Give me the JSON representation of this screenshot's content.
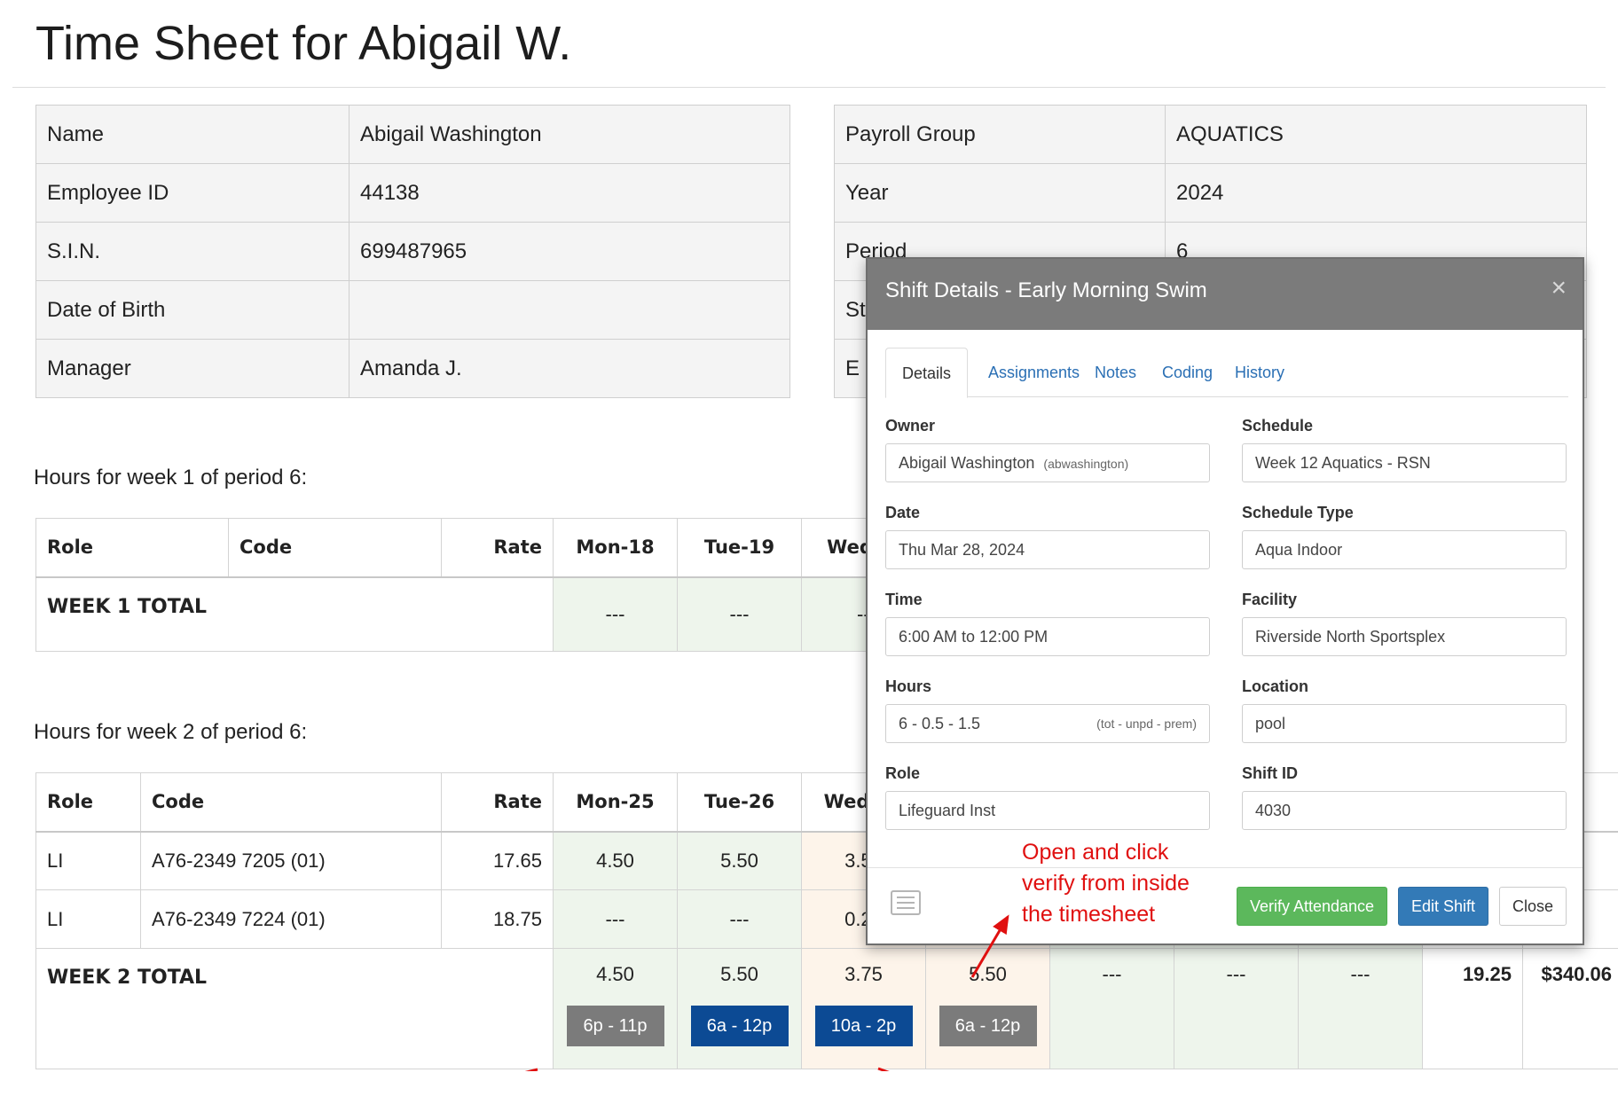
{
  "page_title": "Time Sheet for Abigail W.",
  "info_left": [
    {
      "label": "Name",
      "value": "Abigail Washington"
    },
    {
      "label": "Employee ID",
      "value": "44138"
    },
    {
      "label": "S.I.N.",
      "value": "699487965"
    },
    {
      "label": "Date of Birth",
      "value": ""
    },
    {
      "label": "Manager",
      "value": "Amanda J."
    }
  ],
  "info_right": [
    {
      "label": "Payroll Group",
      "value": "AQUATICS"
    },
    {
      "label": "Year",
      "value": "2024"
    },
    {
      "label": "Period",
      "value": "6"
    },
    {
      "label": "St",
      "value": ""
    },
    {
      "label": "E",
      "value": ""
    }
  ],
  "week1": {
    "label": "Hours for week 1 of period 6:",
    "headers": [
      "Role",
      "Code",
      "Rate",
      "Mon-18",
      "Tue-19",
      "Wed-20"
    ],
    "total_label": "WEEK 1 TOTAL",
    "totals": [
      "---",
      "---",
      "---"
    ]
  },
  "week2": {
    "label": "Hours for week 2 of period 6:",
    "headers": [
      "Role",
      "Code",
      "Rate",
      "Mon-25",
      "Tue-26",
      "Wed-27"
    ],
    "rows": [
      {
        "role": "LI",
        "code": "A76-2349 7205 (01)",
        "rate": "17.65",
        "mon": "4.50",
        "tue": "5.50",
        "wed": "3.50"
      },
      {
        "role": "LI",
        "code": "A76-2349 7224 (01)",
        "rate": "18.75",
        "mon": "---",
        "tue": "---",
        "wed": "0.25"
      }
    ],
    "total_label": "WEEK 2 TOTAL",
    "totals": [
      "4.50",
      "5.50",
      "3.75",
      "5.50",
      "---",
      "---",
      "---"
    ],
    "total_hours": "19.25",
    "total_pay": "$340.06",
    "shifts": [
      "6p - 11p",
      "6a - 12p",
      "10a - 2p",
      "6a - 12p"
    ]
  },
  "modal": {
    "title": "Shift Details - Early Morning Swim",
    "close_glyph": "×",
    "tabs": [
      "Details",
      "Assignments",
      "Notes",
      "Coding",
      "History"
    ],
    "fields": {
      "owner_label": "Owner",
      "owner": "Abigail Washington",
      "owner_user": "(abwashington)",
      "schedule_label": "Schedule",
      "schedule": "Week 12 Aquatics - RSN",
      "date_label": "Date",
      "date": "Thu Mar 28, 2024",
      "schedule_type_label": "Schedule Type",
      "schedule_type": "Aqua Indoor",
      "time_label": "Time",
      "time": "6:00 AM to 12:00 PM",
      "facility_label": "Facility",
      "facility": "Riverside North Sportsplex",
      "hours_label": "Hours",
      "hours": "6 - 0.5 - 1.5",
      "hours_note": "(tot - unpd - prem)",
      "location_label": "Location",
      "location": "pool",
      "role_label": "Role",
      "role": "Lifeguard Inst",
      "shift_id_label": "Shift ID",
      "shift_id": "4030"
    },
    "buttons": {
      "verify": "Verify Attendance",
      "edit": "Edit Shift",
      "close": "Close"
    }
  },
  "annotation": "Open and click\nverify from inside\nthe timesheet",
  "colors": {
    "accent_green": "#5cb85c",
    "accent_blue": "#337ab7",
    "shift_navy": "#0c4a94",
    "annotation_red": "#e01010"
  }
}
